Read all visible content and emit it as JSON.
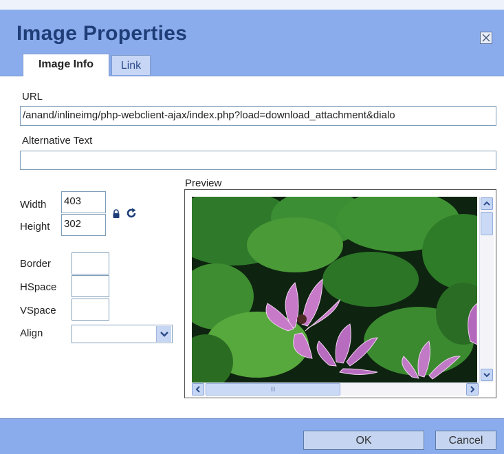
{
  "dialog": {
    "title": "Image Properties",
    "close_icon": "close-icon"
  },
  "tabs": [
    {
      "label": "Image Info",
      "active": true
    },
    {
      "label": "Link",
      "active": false
    }
  ],
  "fields": {
    "url_label": "URL",
    "url_value": "/anand/inlineimg/php-webclient-ajax/index.php?load=download_attachment&dialo",
    "alt_label": "Alternative Text",
    "alt_value": "",
    "width_label": "Width",
    "width_value": "403",
    "height_label": "Height",
    "height_value": "302",
    "border_label": "Border",
    "border_value": "",
    "hspace_label": "HSpace",
    "hspace_value": "",
    "vspace_label": "VSpace",
    "vspace_value": "",
    "align_label": "Align",
    "align_value": ""
  },
  "icons": {
    "lock": "lock-icon",
    "reset": "refresh-icon"
  },
  "preview": {
    "label": "Preview",
    "scroll_dots": "III"
  },
  "buttons": {
    "ok": "OK",
    "cancel": "Cancel"
  },
  "colors": {
    "header": "#8aacec",
    "title": "#1f3e78",
    "button": "#c5d5f1"
  }
}
